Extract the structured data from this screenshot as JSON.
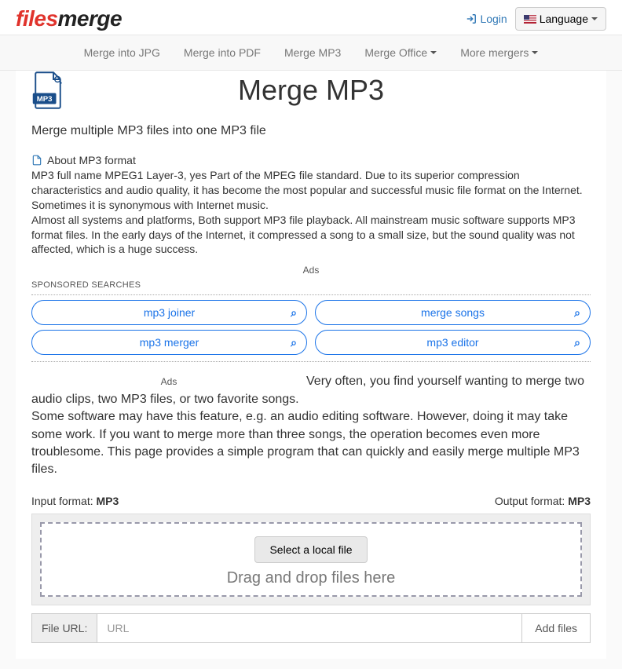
{
  "brand": {
    "part1": "files",
    "part2": "merge"
  },
  "header": {
    "login": "Login",
    "language": "Language"
  },
  "nav": {
    "jpg": "Merge into JPG",
    "pdf": "Merge into PDF",
    "mp3": "Merge MP3",
    "office": "Merge Office",
    "more": "More mergers"
  },
  "page": {
    "title": "Merge MP3",
    "subtitle": "Merge multiple MP3 files into one MP3 file",
    "about_head": "About MP3 format",
    "about_p1": "MP3 full name MPEG1 Layer-3, yes Part of the MPEG file standard. Due to its superior compression characteristics and audio quality, it has become the most popular and successful music file format on the Internet. Sometimes it is synonymous with Internet music.",
    "about_p2": "Almost all systems and platforms, Both support MP3 file playback. All mainstream music software supports MP3 format files. In the early days of the Internet, it compressed a song to a small size, but the sound quality was not affected, which is a huge success.",
    "ads_label": "Ads",
    "sponsored_label": "SPONSORED SEARCHES",
    "para_lead": "Very often, you find yourself wanting to merge two audio clips, two MP3 files, or two favorite songs.",
    "para_rest": "Some software may have this feature, e.g. an audio editing software. However, doing it may take some work. If you want to merge more than three songs, the operation becomes even more troublesome. This page provides a simple program that can quickly and easily merge multiple MP3 files.",
    "input_format_label": "Input format:",
    "input_format": "MP3",
    "output_format_label": "Output format:",
    "output_format": "MP3",
    "select_btn": "Select a local file",
    "drag_text": "Drag and drop files here",
    "file_url_label": "File URL:",
    "url_placeholder": "URL",
    "add_files": "Add files",
    "mp3_badge": "MP3"
  },
  "sponsor": {
    "r1c1": "mp3 joiner",
    "r1c2": "merge songs",
    "r2c1": "mp3 merger",
    "r2c2": "mp3 editor"
  }
}
